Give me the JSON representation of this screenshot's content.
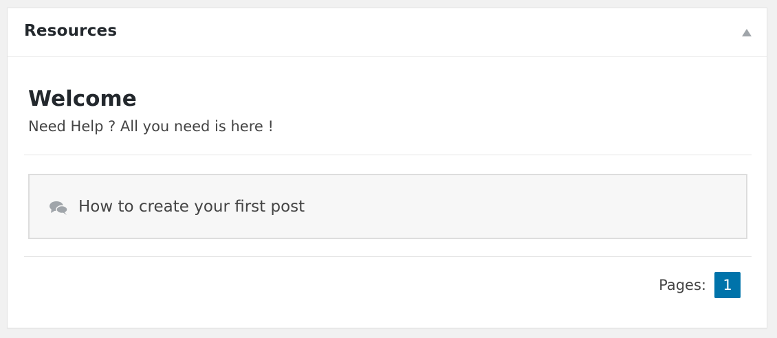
{
  "widget": {
    "title": "Resources",
    "toggle_icon": "triangle-up-icon"
  },
  "intro": {
    "heading": "Welcome",
    "subtitle": "Need Help ? All you need is here !"
  },
  "posts": [
    {
      "icon": "comments-icon",
      "label": "How to create your first post"
    }
  ],
  "pagination": {
    "label": "Pages:",
    "current_page": "1"
  },
  "colors": {
    "background": "#f1f1f1",
    "panel": "#ffffff",
    "accent": "#0073aa",
    "icon_gray": "#a0a5aa"
  }
}
